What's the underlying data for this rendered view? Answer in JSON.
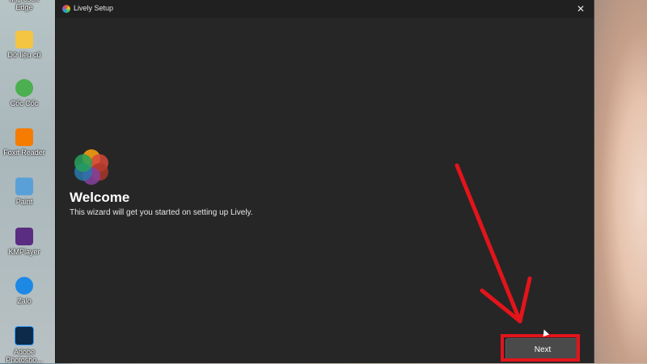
{
  "window": {
    "title": "Lively Setup",
    "close_glyph": "✕"
  },
  "main": {
    "heading": "Welcome",
    "subtitle": "This wizard will get you started on setting up Lively."
  },
  "footer": {
    "next_label": "Next"
  },
  "desktop": {
    "icons": [
      {
        "label": "Microsoft Edge",
        "icon": "edge-icon",
        "color": "#1e88e5"
      },
      {
        "label": "Dữ liệu cũ",
        "icon": "folder-icon",
        "color": "#f4c542"
      },
      {
        "label": "Cốc Cốc",
        "icon": "coccoc-icon",
        "color": "#4caf50"
      },
      {
        "label": "Foxit Reader",
        "icon": "foxit-icon",
        "color": "#f57c00"
      },
      {
        "label": "Paint",
        "icon": "paint-icon",
        "color": "#5aa0d8"
      },
      {
        "label": "KMPlayer",
        "icon": "kmplayer-icon",
        "color": "#5a2d82"
      },
      {
        "label": "Zalo",
        "icon": "zalo-icon",
        "color": "#1e88e5"
      },
      {
        "label": "Adobe Photosho...",
        "icon": "photoshop-icon",
        "color": "#0d2a4a"
      }
    ]
  },
  "colors": {
    "window_bg": "#262626",
    "annotation_red": "#e3141b",
    "next_button": "#4a4a4a"
  }
}
